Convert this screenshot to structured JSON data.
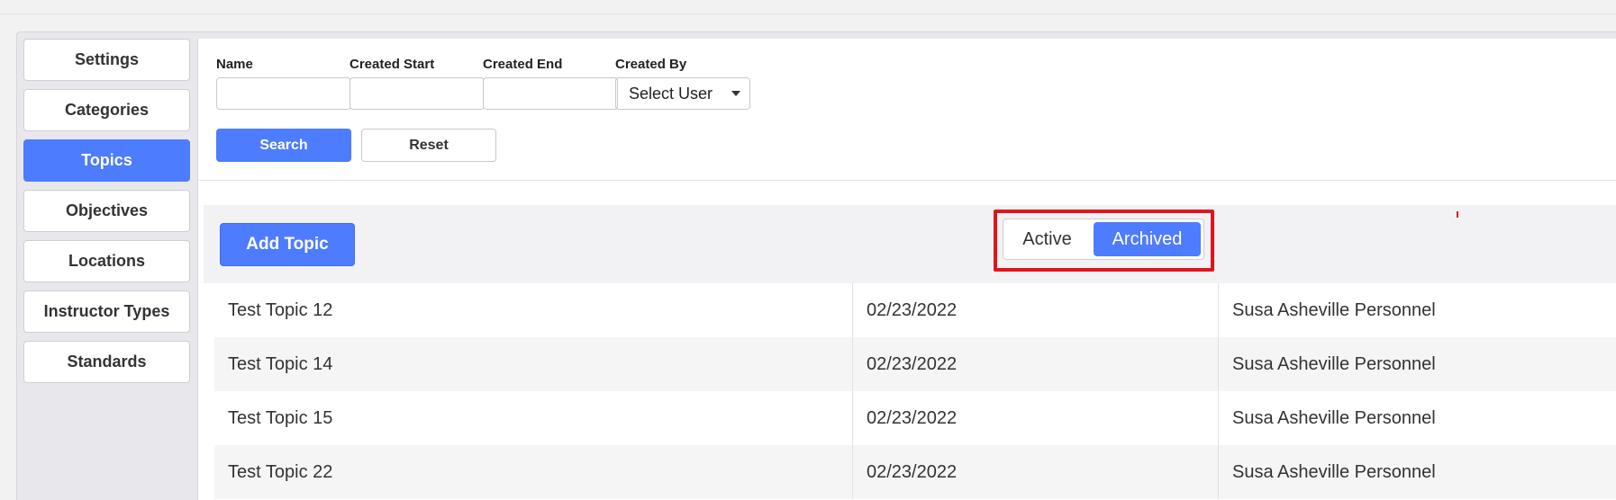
{
  "sidebar": {
    "items": [
      {
        "label": "Settings",
        "active": false
      },
      {
        "label": "Categories",
        "active": false
      },
      {
        "label": "Topics",
        "active": true
      },
      {
        "label": "Objectives",
        "active": false
      },
      {
        "label": "Locations",
        "active": false
      },
      {
        "label": "Instructor Types",
        "active": false
      },
      {
        "label": "Standards",
        "active": false
      }
    ]
  },
  "filters": {
    "name_label": "Name",
    "name_value": "",
    "created_start_label": "Created Start",
    "created_start_value": "",
    "created_end_label": "Created End",
    "created_end_value": "",
    "created_by_label": "Created By",
    "created_by_selected": "Select User",
    "search_label": "Search",
    "reset_label": "Reset"
  },
  "toolbar": {
    "add_label": "Add Topic",
    "toggle": {
      "active_label": "Active",
      "archived_label": "Archived",
      "selected": "Archived"
    }
  },
  "table": {
    "rows": [
      {
        "name": "Test Topic 12",
        "date": "02/23/2022",
        "creator": "Susa Asheville Personnel"
      },
      {
        "name": "Test Topic 14",
        "date": "02/23/2022",
        "creator": "Susa Asheville Personnel"
      },
      {
        "name": "Test Topic 15",
        "date": "02/23/2022",
        "creator": "Susa Asheville Personnel"
      },
      {
        "name": "Test Topic 22",
        "date": "02/23/2022",
        "creator": "Susa Asheville Personnel"
      }
    ]
  },
  "colors": {
    "accent": "#4e7cff",
    "highlight": "#e0141c"
  }
}
